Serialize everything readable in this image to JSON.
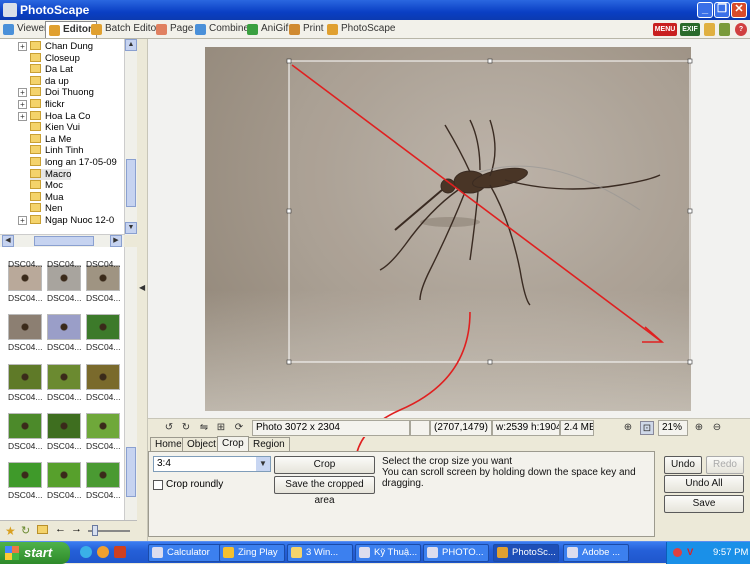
{
  "window": {
    "title": "PhotoScape"
  },
  "tabs": [
    {
      "label": "Viewer",
      "icon": "viewer-icon",
      "color": "#4a90d9"
    },
    {
      "label": "Editor",
      "icon": "editor-icon",
      "color": "#e0a030"
    },
    {
      "label": "Batch Editor",
      "icon": "batch-editor-icon",
      "color": "#e0a030"
    },
    {
      "label": "Page",
      "icon": "page-icon",
      "color": "#e08060"
    },
    {
      "label": "Combine",
      "icon": "combine-icon",
      "color": "#4a90d9"
    },
    {
      "label": "AniGif",
      "icon": "anigif-icon",
      "color": "#3aa040"
    },
    {
      "label": "Print",
      "icon": "print-icon",
      "color": "#d08a30"
    },
    {
      "label": "PhotoScape",
      "icon": "photoscape-icon",
      "color": "#e0a030"
    }
  ],
  "top_right": {
    "menu": "MENU",
    "exif": "EXIF"
  },
  "folder_tree": [
    {
      "label": "Chan Dung",
      "expand": true
    },
    {
      "label": "Closeup",
      "expand": false
    },
    {
      "label": "Da Lat",
      "expand": false
    },
    {
      "label": "da up",
      "expand": false
    },
    {
      "label": "Doi Thuong",
      "expand": true
    },
    {
      "label": "flickr",
      "expand": true
    },
    {
      "label": "Hoa La Co",
      "expand": true
    },
    {
      "label": "Kien Vui",
      "expand": false
    },
    {
      "label": "La Me",
      "expand": false
    },
    {
      "label": "Linh Tinh",
      "expand": false
    },
    {
      "label": "long an 17-05-09",
      "expand": false
    },
    {
      "label": "Macro",
      "expand": false,
      "selected": true
    },
    {
      "label": "Moc",
      "expand": false
    },
    {
      "label": "Mua",
      "expand": false
    },
    {
      "label": "Nen",
      "expand": false
    },
    {
      "label": "Ngap Nuoc 12-0",
      "expand": true
    }
  ],
  "thumbnails": {
    "label": "DSC04...",
    "rows": [
      [
        "#b9a99a",
        "#a8a49e",
        "#9f9482"
      ],
      [
        "#8c7f72",
        "#9a9ec8",
        "#3c7a2a"
      ],
      [
        "#5f7a28",
        "#6b8a30",
        "#7a6a2c"
      ],
      [
        "#4c8a2a",
        "#3e6e1f",
        "#6fa83a"
      ],
      [
        "#3f9a2a",
        "#57a02c",
        "#4a9a32"
      ]
    ]
  },
  "status": {
    "photo_info": "Photo 3072 x 2304",
    "coords": "(2707,1479)",
    "selection_size": "w:2539 h:1904",
    "file_size": "2.4 MB",
    "zoom": "21%"
  },
  "edit_tabs": [
    "Home",
    "Object",
    "Crop",
    "Region"
  ],
  "active_edit_tab": "Crop",
  "crop": {
    "ratio": "3:4",
    "crop_button": "Crop",
    "crop_roundly": "Crop roundly",
    "save_cropped": "Save the cropped area",
    "help_line1": "Select the crop size you want",
    "help_line2": "You can scroll screen by holding down the space key and dragging."
  },
  "history": {
    "undo": "Undo",
    "redo": "Redo",
    "undo_all": "Undo All",
    "save": "Save"
  },
  "taskbar": {
    "start": "start",
    "tasks": [
      "Calculator",
      "Zing Play",
      "3 Win...",
      "Kỹ Thuậ...",
      "PHOTO...",
      "PhotoSc...",
      "Adobe ..."
    ],
    "clock": "9:57 PM"
  },
  "annotation_color": "#e02020"
}
